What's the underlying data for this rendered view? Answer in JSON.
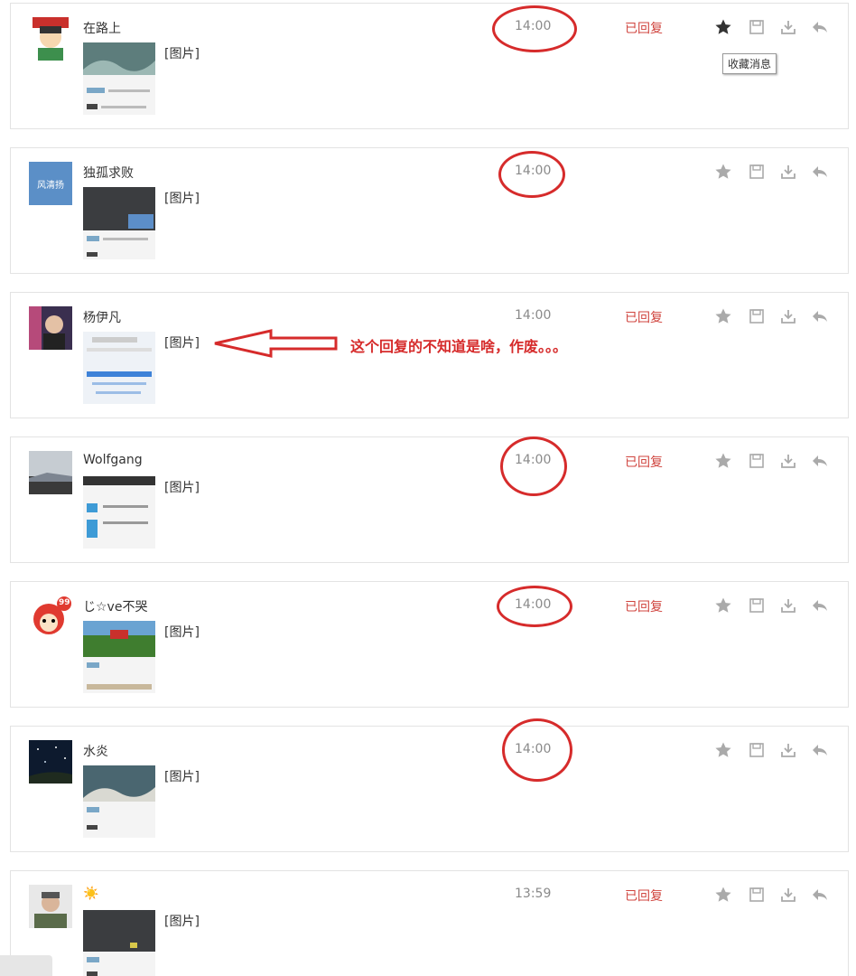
{
  "tooltip": "收藏消息",
  "annotation": "这个回复的不知道是啥，作废。。。",
  "messages": [
    {
      "name": "在路上",
      "content": "[图片]",
      "time": "14:00",
      "status": "已回复",
      "starred": true
    },
    {
      "name": "独孤求败",
      "content": "[图片]",
      "time": "14:00",
      "status": "",
      "starred": false,
      "avatar_text": "风清扬"
    },
    {
      "name": "杨伊凡",
      "content": "[图片]",
      "time": "14:00",
      "status": "已回复",
      "starred": false
    },
    {
      "name": "Wolfgang",
      "content": "[图片]",
      "time": "14:00",
      "status": "已回复",
      "starred": false
    },
    {
      "name": "じ☆ve不哭",
      "content": "[图片]",
      "time": "14:00",
      "status": "已回复",
      "starred": false,
      "avatar_badge": "99"
    },
    {
      "name": "水炎",
      "content": "[图片]",
      "time": "14:00",
      "status": "",
      "starred": false
    },
    {
      "name": "☀️",
      "content": "[图片]",
      "time": "13:59",
      "status": "已回复",
      "starred": false
    }
  ],
  "colors": {
    "accent_red": "#d62b2b",
    "status_red": "#d0453f",
    "icon_gray": "#aaaaaa",
    "icon_dark": "#333333"
  }
}
